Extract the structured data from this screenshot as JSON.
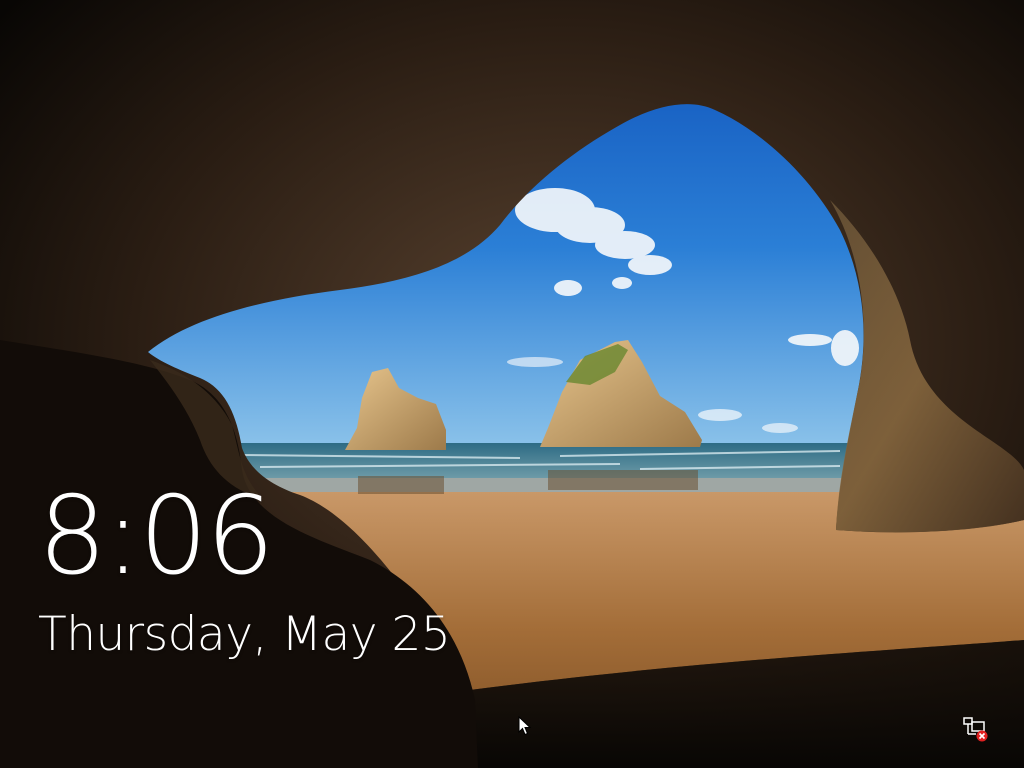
{
  "lock_screen": {
    "time": "8:06",
    "date": "Thursday, May 25"
  },
  "status_icons": {
    "network": "network-disconnected-icon"
  },
  "cursor": {
    "icon": "mouse-pointer-icon"
  },
  "colors": {
    "sky": "#1f6fcf",
    "sand": "#b07a42",
    "rock": "#3a2a1e",
    "text": "#ffffff",
    "alert": "#e02020"
  }
}
